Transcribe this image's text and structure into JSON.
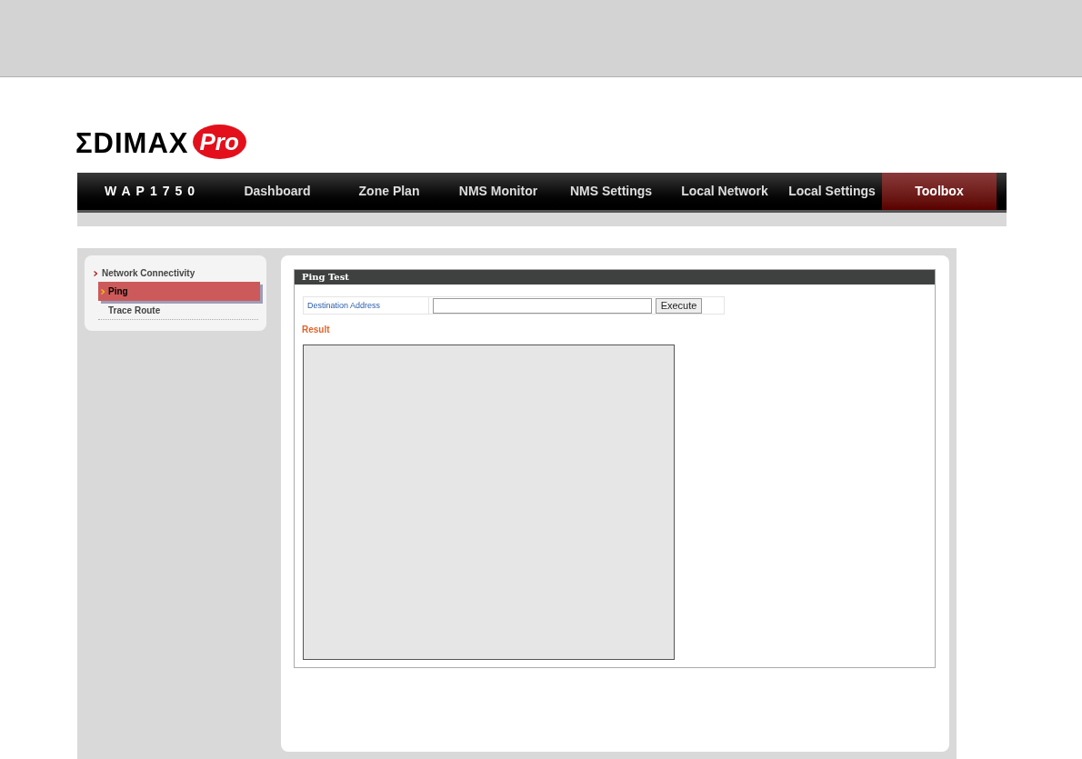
{
  "logo": {
    "brand": "ΣDIMAX",
    "badge": "Pro"
  },
  "nav": {
    "device": "WAP1750",
    "items": [
      {
        "label": "Dashboard",
        "selected": false
      },
      {
        "label": "Zone Plan",
        "selected": false
      },
      {
        "label": "NMS Monitor",
        "selected": false
      },
      {
        "label": "NMS Settings",
        "selected": false
      },
      {
        "label": "Local Network",
        "selected": false
      },
      {
        "label": "Local Settings",
        "selected": false
      },
      {
        "label": "Toolbox",
        "selected": true
      }
    ]
  },
  "sidebar": {
    "group": "Network Connectivity",
    "items": [
      {
        "label": "Ping",
        "selected": true
      },
      {
        "label": "Trace Route",
        "selected": false
      }
    ]
  },
  "panel": {
    "title": "Ping Test",
    "field_label": "Destination Address",
    "button": "Execute",
    "result_label": "Result"
  }
}
